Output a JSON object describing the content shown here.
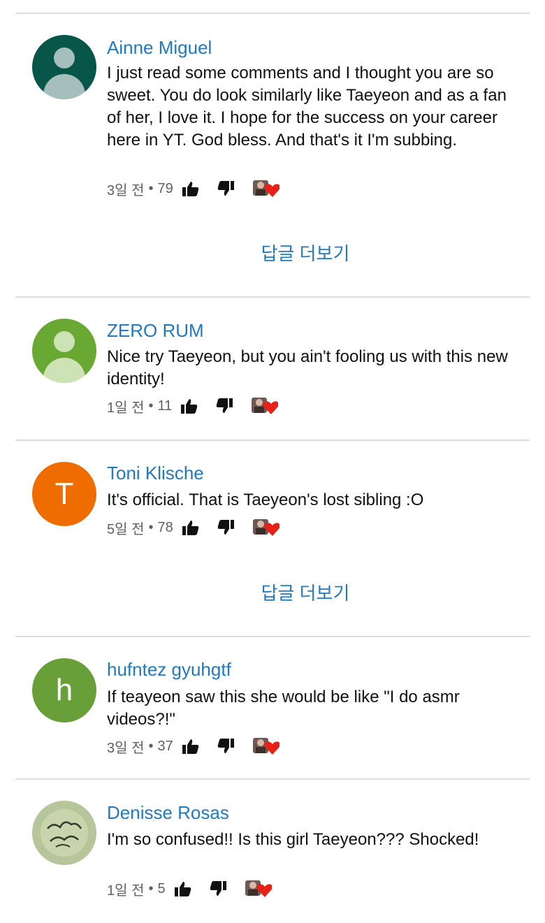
{
  "comments": [
    {
      "author": "Ainne Miguel",
      "text": "I just read some comments and I thought you are so sweet. You do look similarly like Taeyeon and as a fan of her, I love it. I hope for the success on your career here in YT. God bless. And that's it I'm subbing.",
      "time": "3일 전",
      "likes": "79",
      "avatar": {
        "type": "person",
        "bg": "#08554a",
        "fg": "#a7bfbc"
      }
    },
    {
      "author": "ZERO RUM",
      "text": "Nice try Taeyeon, but you ain't fooling us with this new identity!",
      "time": "1일 전",
      "likes": "11",
      "avatar": {
        "type": "person",
        "bg": "#6aa834",
        "fg": "#cde3b5"
      }
    },
    {
      "author": "Toni Klische",
      "text": "It's official. That is Taeyeon's lost sibling :O",
      "time": "5일 전",
      "likes": "78",
      "avatar": {
        "type": "letter",
        "letter": "T",
        "bg": "#ef6c00"
      }
    },
    {
      "author": "hufntez gyuhgtf",
      "text": "If teayeon saw this she would be like \"I do asmr videos?!\"",
      "time": "3일 전",
      "likes": "37",
      "avatar": {
        "type": "letter",
        "letter": "h",
        "bg": "#689f38"
      }
    },
    {
      "author": "Denisse Rosas",
      "text": "I'm so confused!! Is this girl Taeyeon??? Shocked!",
      "time": "1일 전",
      "likes": "5",
      "avatar": {
        "type": "photo",
        "bg": "#a9b98e"
      }
    }
  ],
  "meta_separator": "•",
  "more_replies_label": "답글 더보기",
  "colors": {
    "link": "#1f7ac0",
    "meta": "#606060",
    "heart": "#e62117",
    "divider": "#dcdcdc"
  }
}
